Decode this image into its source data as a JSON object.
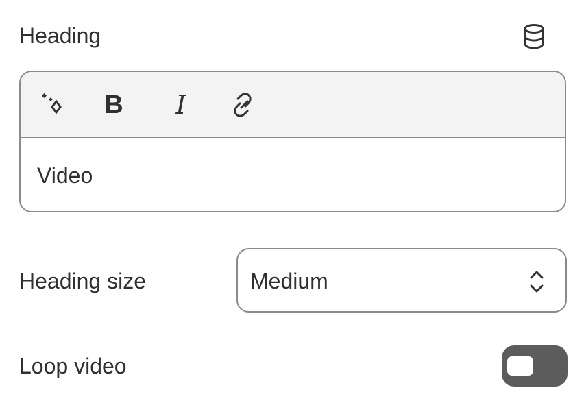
{
  "heading": {
    "label": "Heading",
    "data_source_icon": "database-icon"
  },
  "editor": {
    "toolbar": {
      "ai_icon": "sparkle-icon",
      "bold_label": "B",
      "italic_label": "I",
      "link_icon": "link-icon"
    },
    "content": "Video"
  },
  "heading_size": {
    "label": "Heading size",
    "selected": "Medium",
    "icon": "chevron-up-down-icon"
  },
  "loop_video": {
    "label": "Loop video",
    "enabled": false
  },
  "colors": {
    "text": "#303030",
    "border": "#8a8a8a",
    "toolbar_background": "#f3f3f3",
    "toggle_track": "#5c5c5c"
  }
}
